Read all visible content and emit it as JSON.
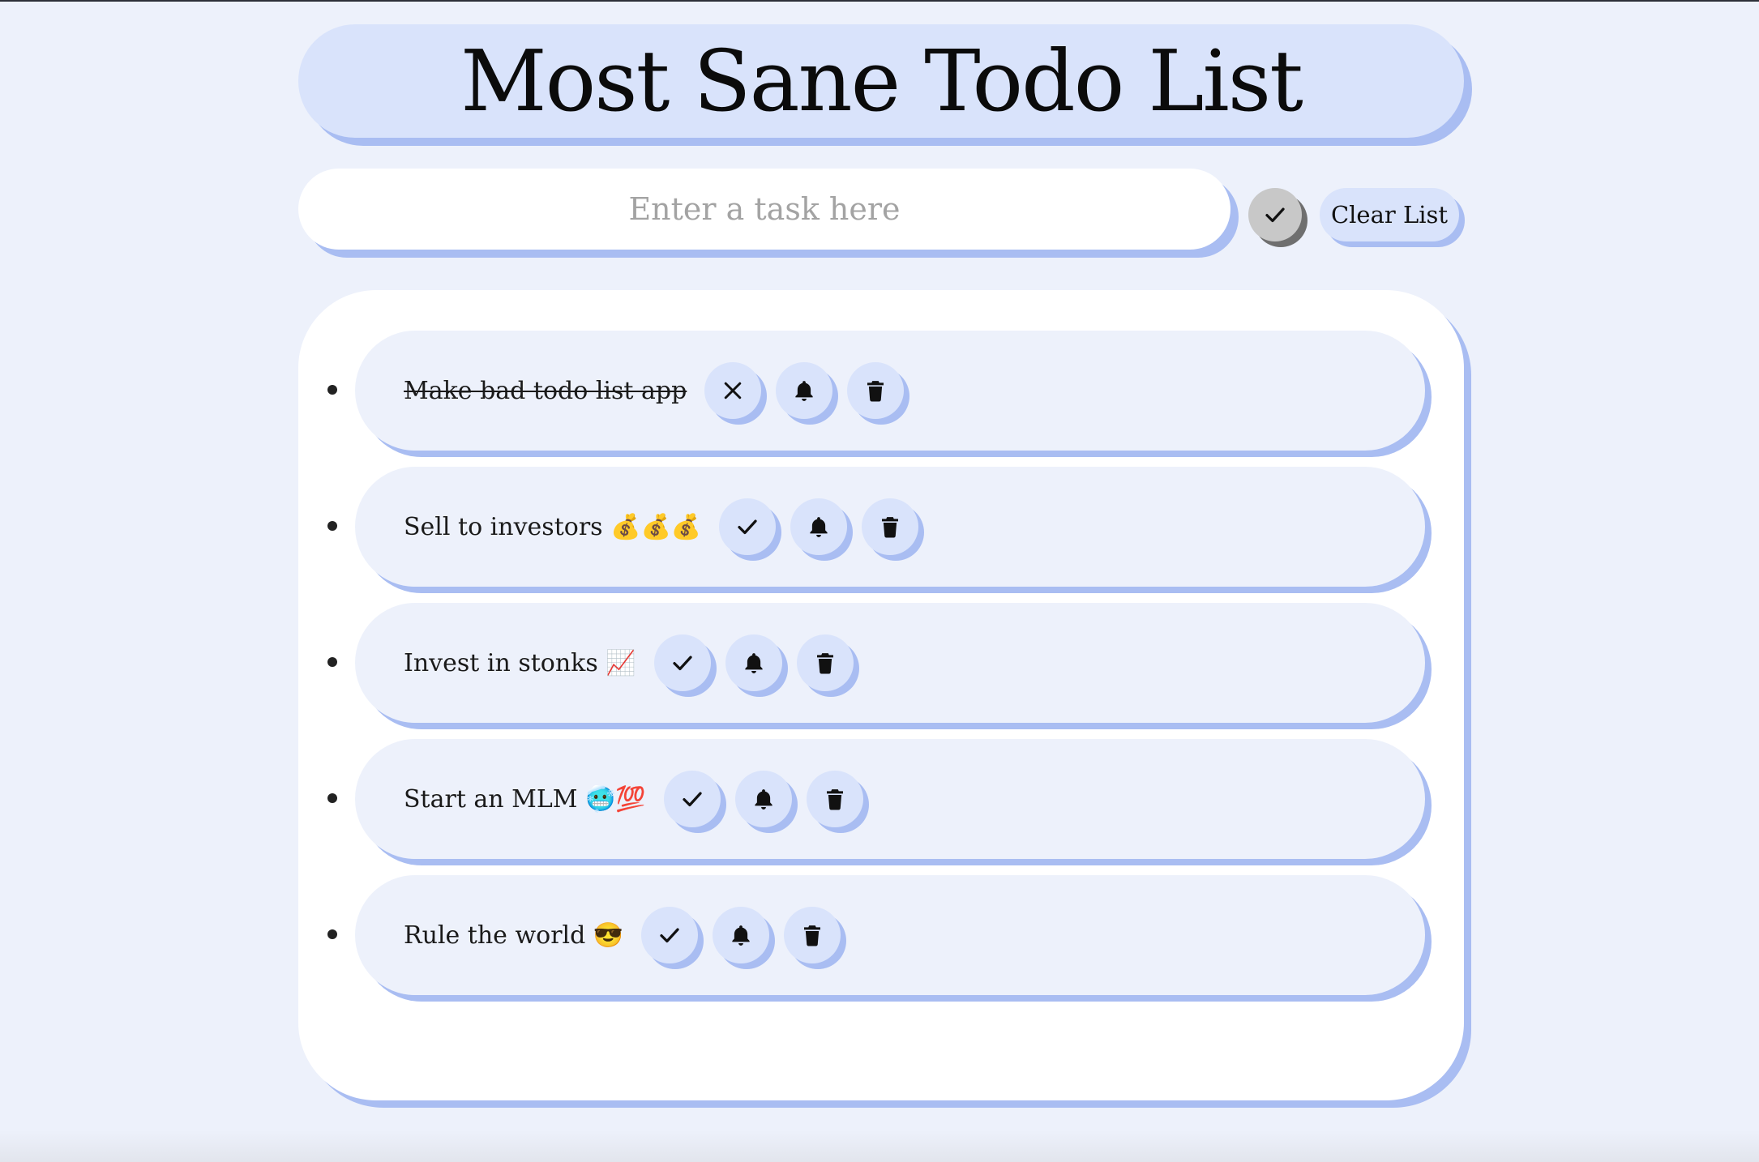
{
  "app": {
    "title": "Most Sane Todo List"
  },
  "entry": {
    "placeholder": "Enter a task here",
    "value": "",
    "submit_icon": "check-icon",
    "clear_label": "Clear List"
  },
  "tasks": [
    {
      "text": "Make bad todo list app",
      "done": true,
      "toggle_icon": "x-icon"
    },
    {
      "text": "Sell to investors 💰💰💰",
      "done": false,
      "toggle_icon": "check-icon"
    },
    {
      "text": "Invest in stonks 📈",
      "done": false,
      "toggle_icon": "check-icon"
    },
    {
      "text": "Start an MLM 🥶💯",
      "done": false,
      "toggle_icon": "check-icon"
    },
    {
      "text": "Rule the world 😎",
      "done": false,
      "toggle_icon": "check-icon"
    }
  ],
  "task_action_icons": [
    "bell-icon",
    "trash-icon"
  ],
  "colors": {
    "page_background": "#edf1fb",
    "accent_light": "#d9e3fb",
    "accent_shadow": "#a9bdf2",
    "panel": "#ffffff",
    "submit_button": "#c8c8c8"
  }
}
